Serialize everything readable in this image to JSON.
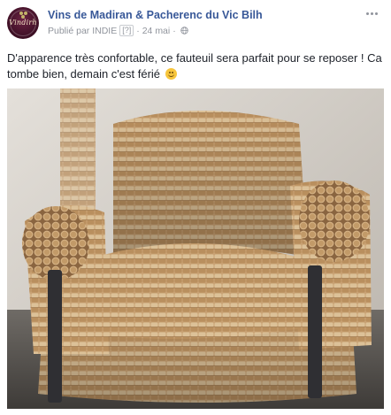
{
  "post": {
    "page_name": "Vins de Madiran & Pacherenc du Vic Bilh",
    "published_by": "Publié par INDIE",
    "help_marker": "[?]",
    "separator": "·",
    "date": "24 mai",
    "visibility_icon": "globe-icon",
    "more_icon": "more-options-icon",
    "avatar_logo_text": "Vindirh",
    "caption": "D'apparence très confortable, ce fauteuil sera parfait pour se reposer ! Ca tombe bien, demain c'est férié",
    "caption_emoji": "smiley-emoji",
    "photo_subject": "armchair-made-of-wine-corks"
  },
  "colors": {
    "page_name": "#385898",
    "meta_text": "#90949c",
    "body_text": "#1d2129",
    "avatar_bg": "#4a1530"
  }
}
